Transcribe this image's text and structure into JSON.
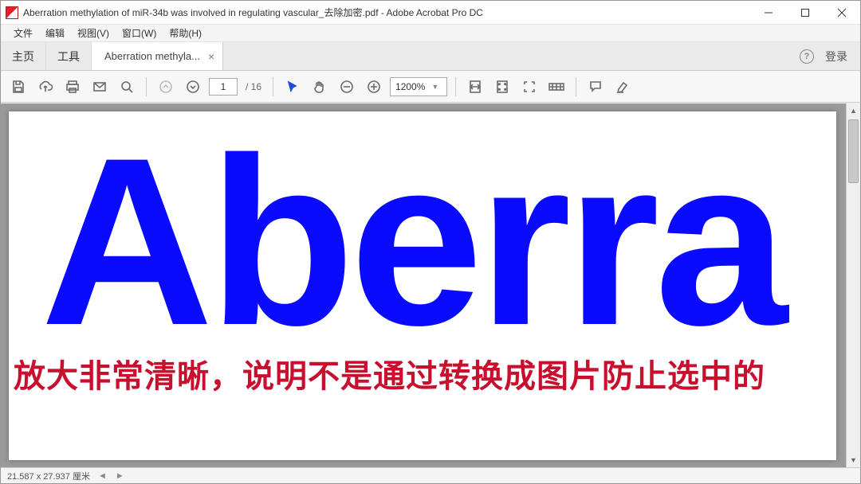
{
  "window": {
    "title": "Aberration methylation of miR-34b was involved in regulating vascular_去除加密.pdf - Adobe Acrobat Pro DC"
  },
  "menu": {
    "file": "文件",
    "edit": "编辑",
    "view": "视图(V)",
    "window": "窗口(W)",
    "help": "帮助(H)"
  },
  "tabs": {
    "home": "主页",
    "tools": "工具",
    "doc_short": "Aberration methyla...",
    "login": "登录",
    "help_glyph": "?"
  },
  "toolbar": {
    "page_current": "1",
    "page_total": "/ 16",
    "zoom_value": "1200%"
  },
  "document": {
    "big_text": "Aberra",
    "red_text": "放大非常清晰，说明不是通过转换成图片防止选中的"
  },
  "status": {
    "coords": "21.587 x 27.937 厘米"
  }
}
